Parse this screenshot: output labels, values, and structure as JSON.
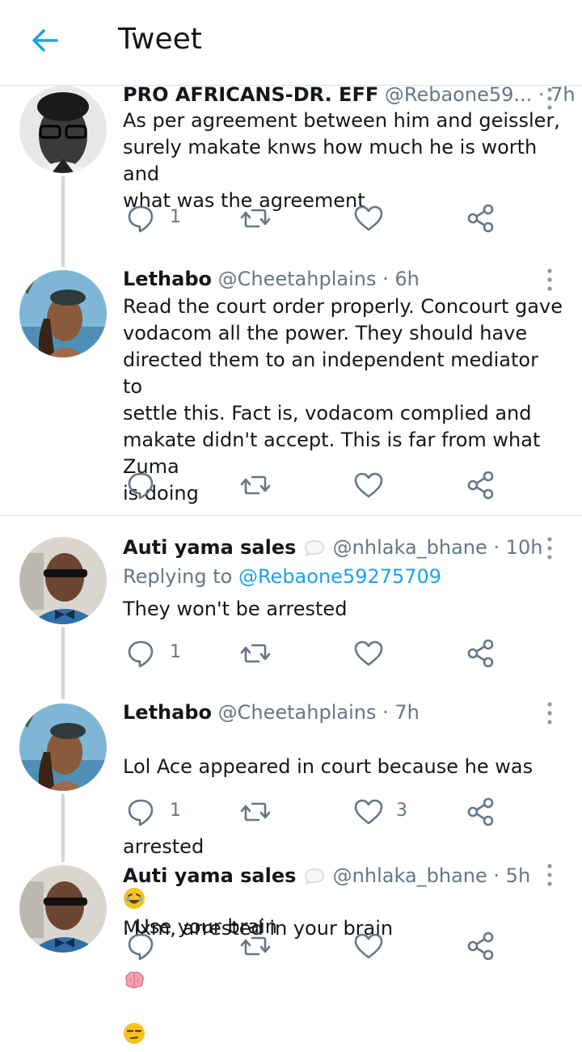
{
  "header": {
    "title": "Tweet"
  },
  "colors": {
    "accent": "#1da1f2",
    "secondary_text": "#657786",
    "divider": "#dfe3e6"
  },
  "tweets": [
    {
      "name": "PRO AFRICANS-DR. EFF",
      "handle": "@Rebaone59...",
      "time": "· 7h",
      "text": "As per agreement between him and geissler,\nsurely makate knws how much he is worth and\nwhat was the agreement",
      "reply_count": "1",
      "like_count": ""
    },
    {
      "name": "Lethabo",
      "handle": "@Cheetahplains",
      "time": "· 6h",
      "text": "Read the court order properly. Concourt gave\nvodacom all the power. They should have\ndirected them to an independent mediator to\nsettle this. Fact is, vodacom complied and\nmakate didn't accept. This is far from what Zuma\nis doing",
      "reply_count": "",
      "like_count": ""
    },
    {
      "name": "Auti yama sales",
      "handle": "@nhlaka_bhane",
      "time": "· 10h",
      "replying_label": "Replying to",
      "replying_handle": "@Rebaone59275709",
      "text": "They won't be arrested",
      "reply_count": "1",
      "like_count": ""
    },
    {
      "name": "Lethabo",
      "handle": "@Cheetahplains",
      "time": "· 7h",
      "text_line1": "Lol Ace appeared in court because he was",
      "text_line2a": "arrested",
      "text_line2b": ". Use your brain",
      "reply_count": "1",
      "like_count": "3"
    },
    {
      "name": "Auti yama sales",
      "handle": "@nhlaka_bhane",
      "time": "· 5h",
      "text": "Mxm, arrested in your brain",
      "reply_count": "",
      "like_count": ""
    }
  ]
}
